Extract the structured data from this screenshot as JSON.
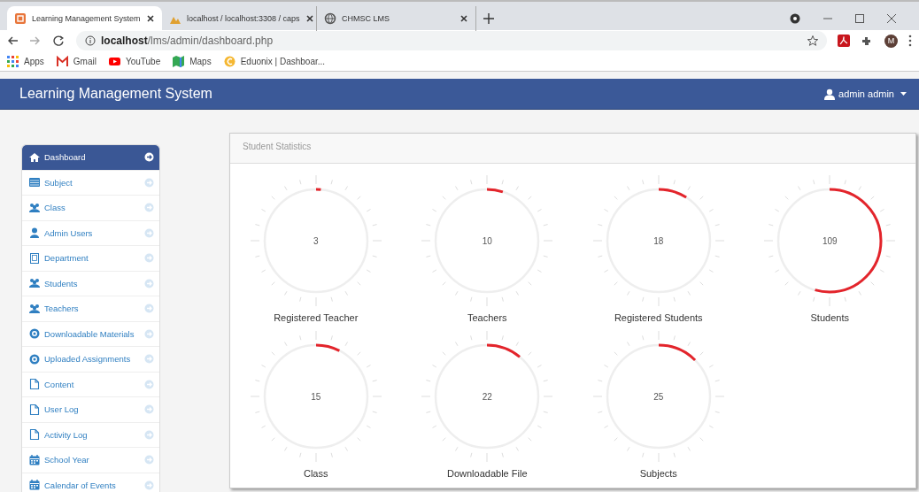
{
  "browser": {
    "tabs": [
      {
        "title": "Learning Management System",
        "kind": "lms",
        "selected": true
      },
      {
        "title": "localhost / localhost:3308 / caps",
        "kind": "db",
        "selected": false
      },
      {
        "title": "CHMSC LMS",
        "kind": "globe",
        "selected": false
      }
    ],
    "address": {
      "host": "localhost",
      "path": "/lms/admin/dashboard.php"
    },
    "bookmarks": [
      {
        "label": "Apps",
        "kind": "apps"
      },
      {
        "label": "Gmail",
        "kind": "mail"
      },
      {
        "label": "YouTube",
        "kind": "video"
      },
      {
        "label": "Maps",
        "kind": "map"
      },
      {
        "label": "Eduonix | Dashboar...",
        "kind": "edu"
      }
    ],
    "profile": "M"
  },
  "navbar": {
    "title": "Learning Management System",
    "user": "admin admin"
  },
  "sidebar": {
    "items": [
      {
        "label": "Dashboard",
        "kind": "home",
        "selected": true
      },
      {
        "label": "Subject",
        "kind": "table",
        "selected": false
      },
      {
        "label": "Class",
        "kind": "group",
        "selected": false
      },
      {
        "label": "Admin Users",
        "kind": "user",
        "selected": false
      },
      {
        "label": "Department",
        "kind": "building",
        "selected": false
      },
      {
        "label": "Students",
        "kind": "group",
        "selected": false
      },
      {
        "label": "Teachers",
        "kind": "group",
        "selected": false
      },
      {
        "label": "Downloadable Materials",
        "kind": "disc",
        "selected": false
      },
      {
        "label": "Uploaded Assignments",
        "kind": "disc",
        "selected": false
      },
      {
        "label": "Content",
        "kind": "file",
        "selected": false
      },
      {
        "label": "User Log",
        "kind": "file",
        "selected": false
      },
      {
        "label": "Activity Log",
        "kind": "file",
        "selected": false
      },
      {
        "label": "School Year",
        "kind": "calendar",
        "selected": false
      },
      {
        "label": "Calendar of Events",
        "kind": "calendar",
        "selected": false
      }
    ]
  },
  "panel": {
    "title": "Student Statistics",
    "gauges": [
      {
        "value": "3",
        "label": "Registered Teacher",
        "level": 0.015
      },
      {
        "value": "10",
        "label": "Teachers",
        "level": 0.05
      },
      {
        "value": "18",
        "label": "Registered Students",
        "level": 0.09
      },
      {
        "value": "109",
        "label": "Students",
        "level": 0.545
      },
      {
        "value": "15",
        "label": "Class",
        "level": 0.075
      },
      {
        "value": "22",
        "label": "Downloadable File",
        "level": 0.11
      },
      {
        "value": "25",
        "label": "Subjects",
        "level": 0.125
      }
    ]
  }
}
